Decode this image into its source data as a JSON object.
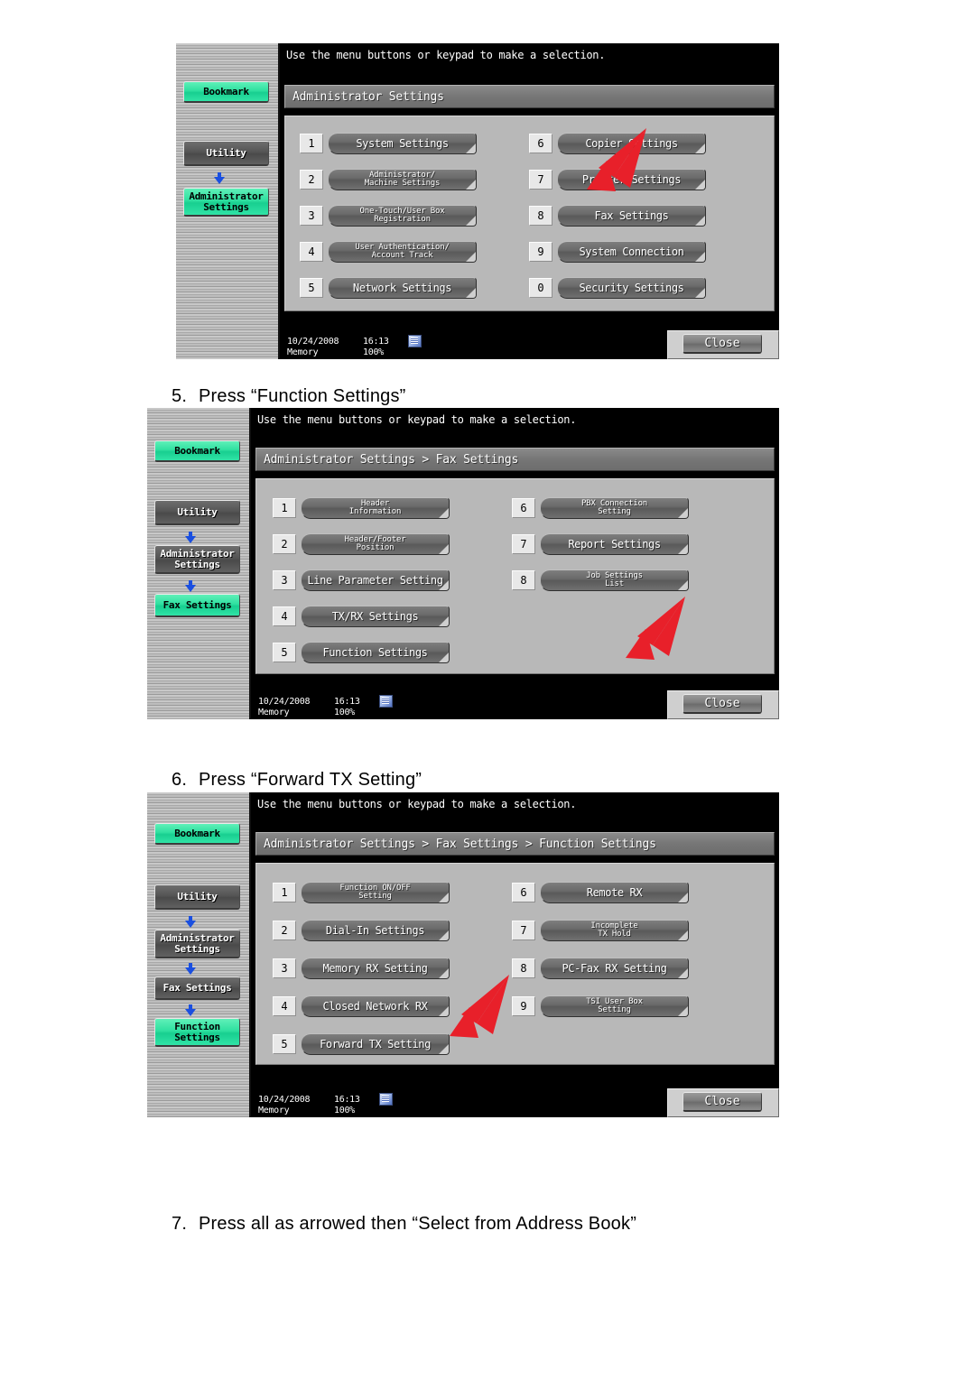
{
  "document": {
    "captions": [
      {
        "num": "5.",
        "text": "Press “Function Settings”"
      },
      {
        "num": "6.",
        "text": "Press “Forward TX Setting”"
      },
      {
        "num": "7.",
        "text": "Press all as arrowed then “Select from Address Book”"
      }
    ]
  },
  "common": {
    "hint": "Use the menu buttons or keypad to make a selection.",
    "close_label": "Close",
    "memory_label": "Memory",
    "memory_value": "100%",
    "date": "10/24/2008",
    "time": "16:13",
    "network_icon": "network-status-icon",
    "accent_green": "#2fe0a0",
    "arrow_blue": "#1a4fe0",
    "annotation_red": "#e8202a"
  },
  "panel1": {
    "title": "Administrator Settings",
    "rail": [
      {
        "label": "Bookmark",
        "style": "green"
      },
      {
        "label": "Utility",
        "style": "grey"
      },
      {
        "label": "Administrator\nSettings",
        "style": "green"
      }
    ],
    "menu_left": [
      {
        "num": "1",
        "label": "System Settings",
        "lines": 1
      },
      {
        "num": "2",
        "label": "Administrator/\nMachine Settings",
        "lines": 2
      },
      {
        "num": "3",
        "label": "One-Touch/User Box\nRegistration",
        "lines": 2
      },
      {
        "num": "4",
        "label": "User Authentication/\nAccount Track",
        "lines": 2
      },
      {
        "num": "5",
        "label": "Network Settings",
        "lines": 1
      }
    ],
    "menu_right": [
      {
        "num": "6",
        "label": "Copier Settings",
        "lines": 1
      },
      {
        "num": "7",
        "label": "Printer Settings",
        "lines": 1
      },
      {
        "num": "8",
        "label": "Fax Settings",
        "lines": 1
      },
      {
        "num": "9",
        "label": "System Connection",
        "lines": 1
      },
      {
        "num": "0",
        "label": "Security Settings",
        "lines": 1
      }
    ],
    "annotation_target": "Fax Settings"
  },
  "panel2": {
    "title": "Administrator Settings > Fax Settings",
    "rail": [
      {
        "label": "Bookmark",
        "style": "green"
      },
      {
        "label": "Utility",
        "style": "grey"
      },
      {
        "label": "Administrator\nSettings",
        "style": "grey"
      },
      {
        "label": "Fax Settings",
        "style": "green"
      }
    ],
    "menu_left": [
      {
        "num": "1",
        "label": "Header\nInformation",
        "lines": 2
      },
      {
        "num": "2",
        "label": "Header/Footer\nPosition",
        "lines": 2
      },
      {
        "num": "3",
        "label": "Line Parameter Setting",
        "lines": 1
      },
      {
        "num": "4",
        "label": "TX/RX Settings",
        "lines": 1
      },
      {
        "num": "5",
        "label": "Function Settings",
        "lines": 1
      }
    ],
    "menu_right": [
      {
        "num": "6",
        "label": "PBX Connection\nSetting",
        "lines": 2
      },
      {
        "num": "7",
        "label": "Report Settings",
        "lines": 1
      },
      {
        "num": "8",
        "label": "Job Settings\nList",
        "lines": 2
      }
    ],
    "annotation_target": "Function Settings"
  },
  "panel3": {
    "title": "Administrator Settings > Fax Settings > Function Settings",
    "rail": [
      {
        "label": "Bookmark",
        "style": "green"
      },
      {
        "label": "Utility",
        "style": "grey"
      },
      {
        "label": "Administrator\nSettings",
        "style": "grey"
      },
      {
        "label": "Fax Settings",
        "style": "grey"
      },
      {
        "label": "Function\nSettings",
        "style": "green"
      }
    ],
    "menu_left": [
      {
        "num": "1",
        "label": "Function ON/OFF\nSetting",
        "lines": 2
      },
      {
        "num": "2",
        "label": "Dial-In Settings",
        "lines": 1
      },
      {
        "num": "3",
        "label": "Memory RX Setting",
        "lines": 1
      },
      {
        "num": "4",
        "label": "Closed Network RX",
        "lines": 1
      },
      {
        "num": "5",
        "label": "Forward TX Setting",
        "lines": 1
      }
    ],
    "menu_right": [
      {
        "num": "6",
        "label": "Remote RX",
        "lines": 1
      },
      {
        "num": "7",
        "label": "Incomplete\nTX Hold",
        "lines": 2
      },
      {
        "num": "8",
        "label": "PC-Fax RX Setting",
        "lines": 1
      },
      {
        "num": "9",
        "label": "TSI User Box\nSetting",
        "lines": 2
      }
    ],
    "annotation_target": "Forward TX Setting"
  }
}
